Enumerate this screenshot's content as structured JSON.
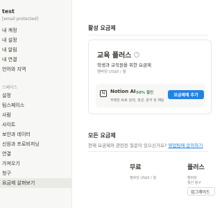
{
  "sidebar": {
    "user": {
      "name": "test",
      "email": "[email protected]"
    },
    "account_items": [
      {
        "label": "내 계정"
      },
      {
        "label": "내 설정"
      },
      {
        "label": "내 알림"
      },
      {
        "label": "내 연결"
      },
      {
        "label": "언어와 지역"
      }
    ],
    "workspace_header": "스페이스",
    "workspace_items": [
      {
        "label": "설정"
      },
      {
        "label": "팀스페이스"
      },
      {
        "label": "사람"
      },
      {
        "label": "사이트"
      },
      {
        "label": "보안과 데이터"
      },
      {
        "label": "신원과 프로비저닝"
      },
      {
        "label": "연결"
      },
      {
        "label": "가져오기"
      },
      {
        "label": "청구"
      },
      {
        "label": "요금제 살펴보기",
        "active": true
      }
    ]
  },
  "main": {
    "active_plan_title": "활성 요금제",
    "plan": {
      "name": "교육 플러스",
      "info_icon": "info-icon",
      "description": "학생과 교직원을 위한 요금제",
      "price": "멤버당 US$0 / 월"
    },
    "ai_addon": {
      "icon": "notion-logo-icon",
      "title": "Notion AI",
      "discount": "50% 할인",
      "description": "무제한 AI로 검색, 생성, 분석 및 채팅",
      "add_button": "요금제에 추가"
    },
    "all_plans_title": "모든 요금제",
    "all_plans_desc": "현재 요금제와 관련된 질문이 있으신가요? ",
    "all_plans_link": "영업팀에 문의하기",
    "plans": [
      {
        "name": "무료",
        "price": "멤버당 US$0 / 월"
      },
      {
        "name": "플러스",
        "price": "멤버당",
        "price2": "월간 청구"
      }
    ],
    "upgrade_button": "업그레이드"
  },
  "colors": {
    "accent": "#2383e2",
    "discount": "#448361",
    "sidebar_bg": "#f7f7f5",
    "active_item_bg": "#e9e9e6"
  }
}
